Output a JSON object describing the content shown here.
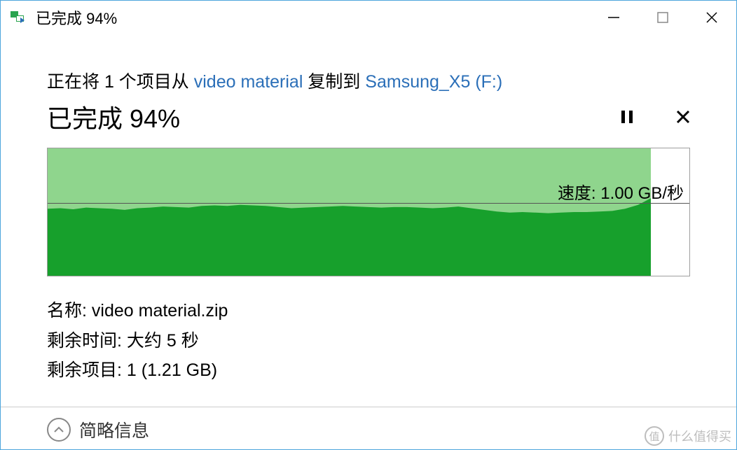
{
  "titlebar": {
    "title": "已完成 94%"
  },
  "copy_line": {
    "prefix": "正在将 1 个项目从 ",
    "source": "video material",
    "middle": " 复制到 ",
    "destination": "Samsung_X5 (F:)"
  },
  "status": {
    "text": "已完成 94%"
  },
  "speed": {
    "label": "速度: 1.00 GB/秒"
  },
  "details": {
    "name_label": "名称: ",
    "name_value": "video material.zip",
    "time_label": "剩余时间: ",
    "time_value": "大约 5 秒",
    "items_label": "剩余项目: ",
    "items_value": "1 (1.21 GB)"
  },
  "footer": {
    "less_info": "简略信息"
  },
  "watermark": {
    "badge": "值",
    "text": "什么值得买"
  },
  "chart_data": {
    "type": "area",
    "title": "",
    "xlabel": "",
    "ylabel": "",
    "ylim": [
      0,
      2.3
    ],
    "progress_fraction": 0.94,
    "speed_line_value": 1.0,
    "x": [
      0,
      0.02,
      0.04,
      0.06,
      0.08,
      0.1,
      0.12,
      0.14,
      0.16,
      0.18,
      0.2,
      0.22,
      0.24,
      0.26,
      0.28,
      0.3,
      0.32,
      0.34,
      0.36,
      0.38,
      0.4,
      0.42,
      0.44,
      0.46,
      0.48,
      0.5,
      0.52,
      0.54,
      0.56,
      0.58,
      0.6,
      0.62,
      0.64,
      0.66,
      0.68,
      0.7,
      0.72,
      0.74,
      0.76,
      0.78,
      0.8,
      0.82,
      0.84,
      0.86,
      0.88,
      0.9,
      0.92,
      0.94
    ],
    "values": [
      1.21,
      1.22,
      1.2,
      1.23,
      1.22,
      1.21,
      1.19,
      1.22,
      1.23,
      1.25,
      1.24,
      1.23,
      1.26,
      1.27,
      1.26,
      1.28,
      1.27,
      1.26,
      1.24,
      1.22,
      1.23,
      1.24,
      1.25,
      1.26,
      1.25,
      1.24,
      1.23,
      1.24,
      1.24,
      1.23,
      1.22,
      1.23,
      1.25,
      1.22,
      1.19,
      1.16,
      1.14,
      1.15,
      1.14,
      1.13,
      1.14,
      1.15,
      1.15,
      1.16,
      1.17,
      1.21,
      1.28,
      1.4
    ],
    "colors": {
      "area_dark": "#17a02c",
      "area_light": "#8fd58d"
    }
  }
}
